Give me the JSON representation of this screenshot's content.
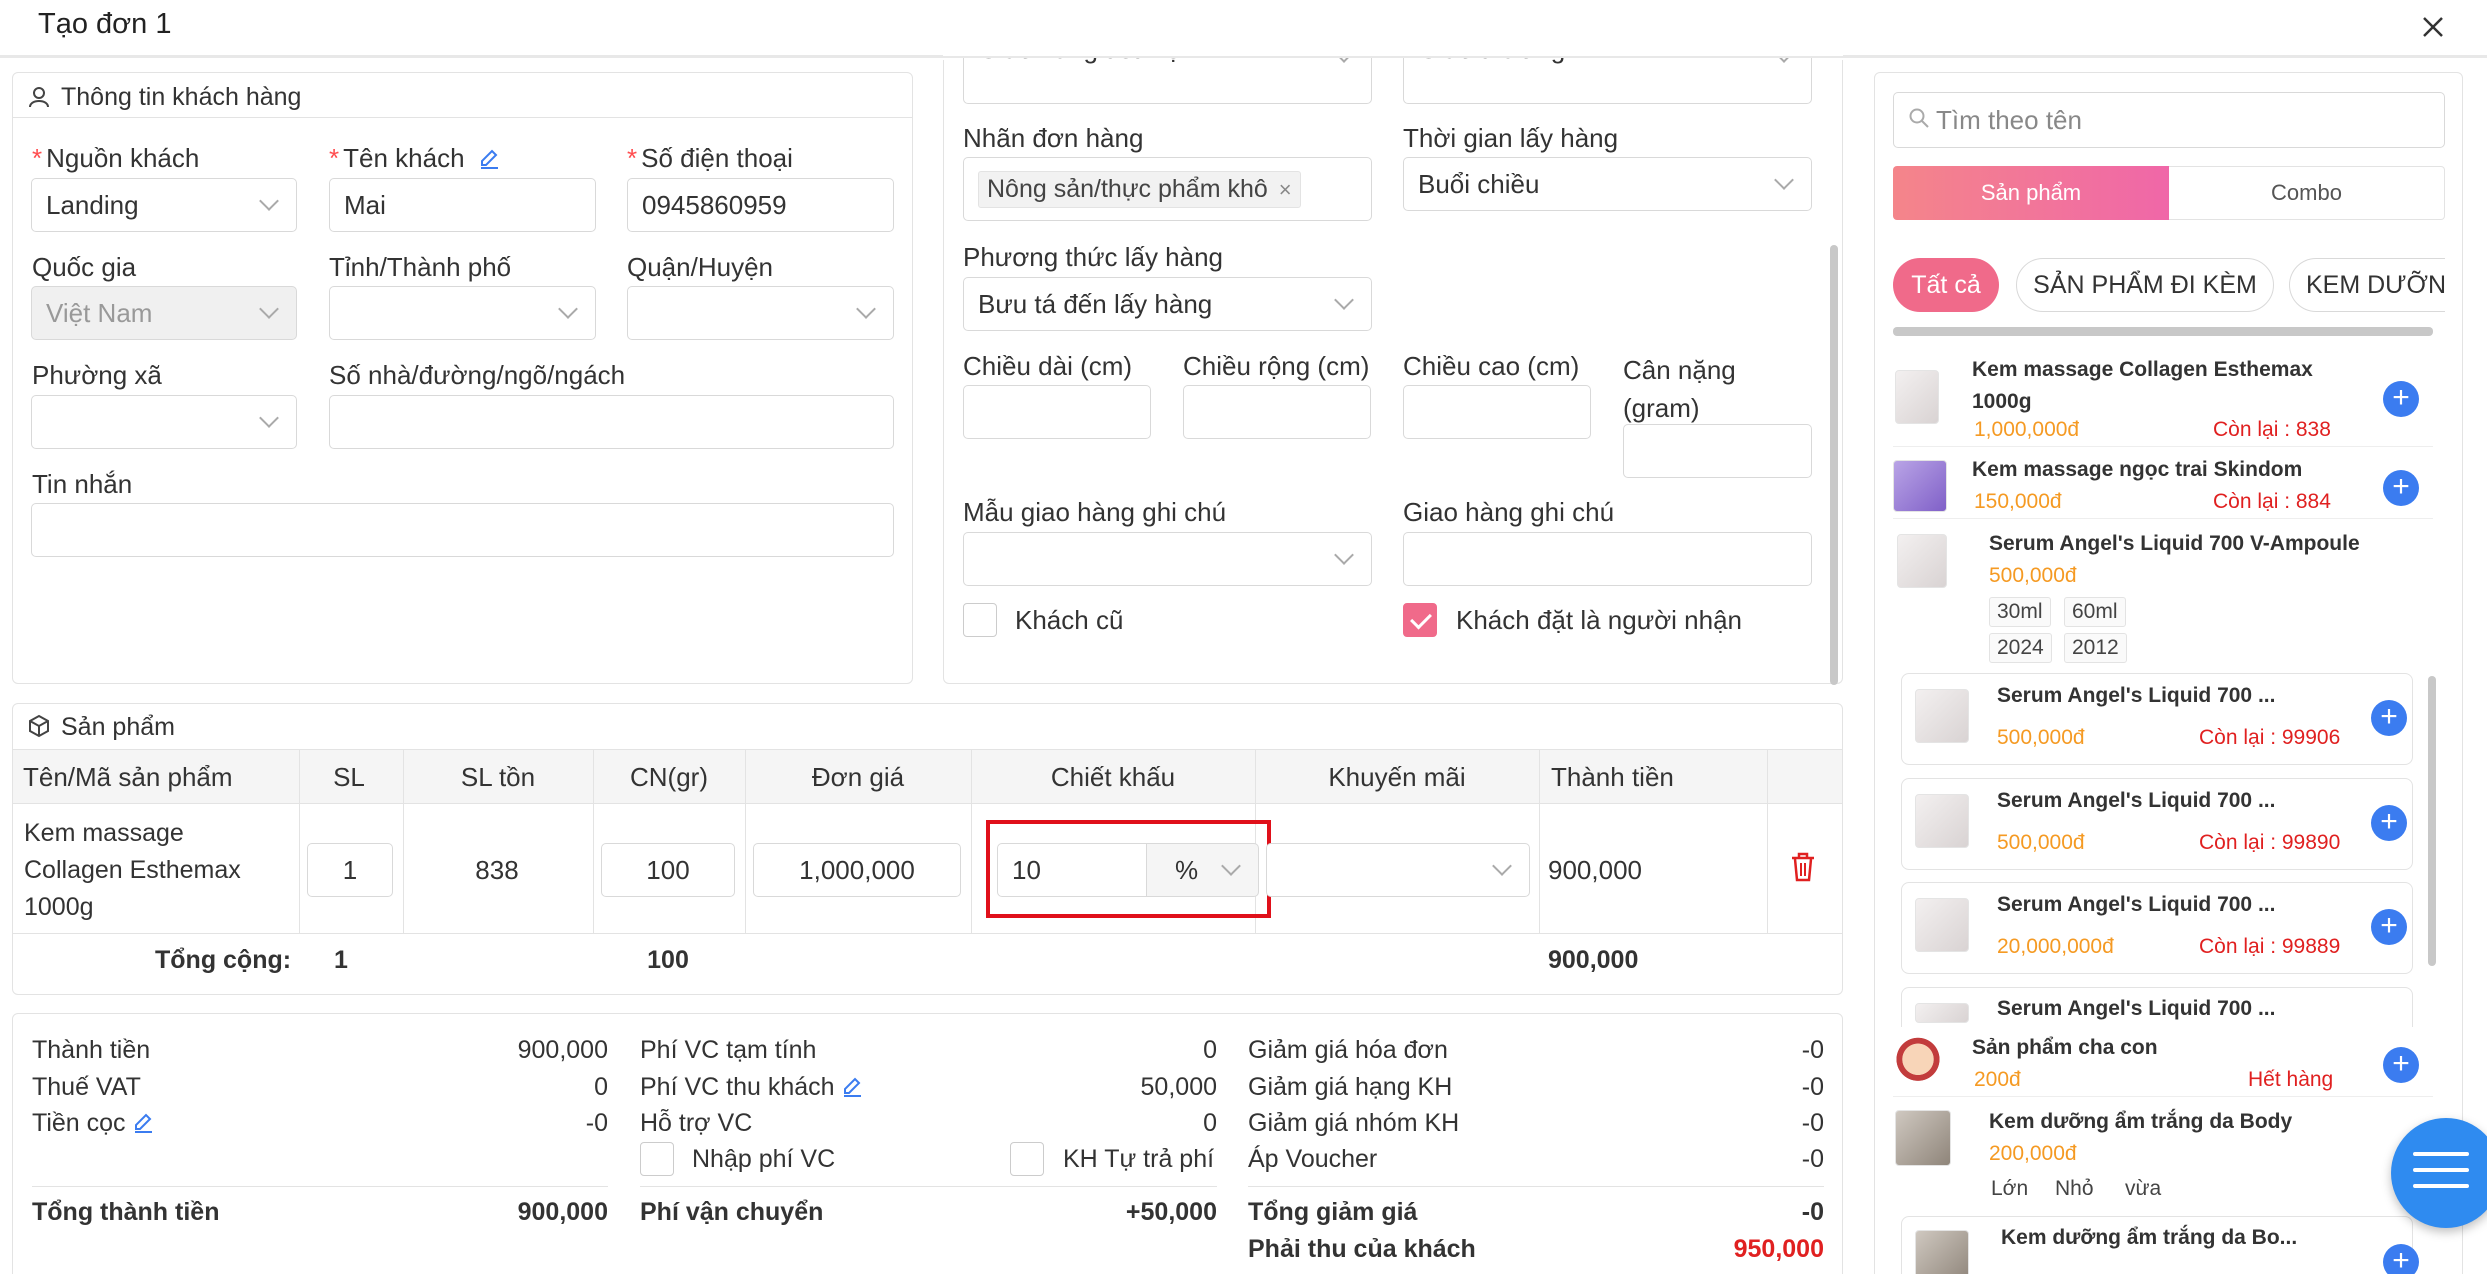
{
  "modal": {
    "title": "Tạo đơn 1"
  },
  "customer": {
    "section_title": "Thông tin khách hàng",
    "source_label": "Nguồn khách",
    "source_value": "Landing",
    "name_label": "Tên khách",
    "name_value": "Mai",
    "phone_label": "Số điện thoại",
    "phone_value": "0945860959",
    "country_label": "Quốc gia",
    "country_value": "Việt Nam",
    "province_label": "Tỉnh/Thành phố",
    "district_label": "Quận/Huyện",
    "ward_label": "Phường xã",
    "address_label": "Số nhà/đường/ngõ/ngách",
    "message_label": "Tin nhắn"
  },
  "shipping": {
    "carrier_value": "Giao hàng tiết kiệm",
    "service_value": "Giao thường",
    "order_tag_label": "Nhãn đơn hàng",
    "order_tag_value": "Nông sản/thực phẩm khô",
    "pickup_time_label": "Thời gian lấy hàng",
    "pickup_time_value": "Buổi chiều",
    "pickup_method_label": "Phương thức lấy hàng",
    "pickup_method_value": "Bưu tá đến lấy hàng",
    "length_label": "Chiều dài (cm)",
    "width_label": "Chiều rộng (cm)",
    "height_label": "Chiều cao (cm)",
    "weight_label_1": "Cân nặng",
    "weight_label_2": "(gram)",
    "note_template_label": "Mẫu giao hàng ghi chú",
    "note_label": "Giao hàng ghi chú",
    "old_customer_label": "Khách cũ",
    "buyer_is_receiver_label": "Khách đặt là người nhận",
    "buyer_is_receiver_checked": true
  },
  "products": {
    "section_title": "Sản phẩm",
    "headers": {
      "name": "Tên/Mã sản phẩm",
      "qty": "SL",
      "stock": "SL tồn",
      "weight": "CN(gr)",
      "price": "Đơn giá",
      "discount": "Chiết khấu",
      "promo": "Khuyến mãi",
      "total": "Thành tiền"
    },
    "row": {
      "name_1": "Kem massage",
      "name_2": "Collagen Esthemax",
      "name_3": "1000g",
      "qty": "1",
      "stock": "838",
      "weight": "100",
      "price": "1,000,000",
      "discount": "10",
      "discount_unit": "%",
      "total": "900,000"
    },
    "footer": {
      "label": "Tổng cộng:",
      "qty": "1",
      "weight": "100",
      "total": "900,000"
    }
  },
  "summary": {
    "col1": {
      "subtotal_label": "Thành tiền",
      "subtotal_value": "900,000",
      "vat_label": "Thuế VAT",
      "vat_value": "0",
      "deposit_label": "Tiền cọc",
      "deposit_value": "-0",
      "grand_label": "Tổng thành tiền",
      "grand_value": "900,000"
    },
    "col2": {
      "est_fee_label": "Phí VC tạm tính",
      "est_fee_value": "0",
      "charged_fee_label": "Phí VC thu khách",
      "charged_fee_value": "50,000",
      "support_label": "Hỗ trợ VC",
      "support_value": "0",
      "enter_fee_label": "Nhập phí VC",
      "self_pay_label": "KH Tự trả phí",
      "ship_label": "Phí vận chuyển",
      "ship_value": "+50,000"
    },
    "col3": {
      "invoice_disc_label": "Giảm giá hóa đơn",
      "invoice_disc_value": "-0",
      "rank_disc_label": "Giảm giá hạng KH",
      "rank_disc_value": "-0",
      "group_disc_label": "Giảm giá nhóm KH",
      "group_disc_value": "-0",
      "voucher_label": "Áp Voucher",
      "voucher_value": "-0",
      "total_disc_label": "Tổng giảm giá",
      "total_disc_value": "-0",
      "collect_label": "Phải thu của khách",
      "collect_value": "950,000"
    }
  },
  "catalog": {
    "search_placeholder": "Tìm theo tên",
    "tab_products": "Sản phẩm",
    "tab_combo": "Combo",
    "filters": [
      "Tất cả",
      "SẢN PHẨM ĐI KÈM",
      "KEM DƯỠN"
    ],
    "items": [
      {
        "name_1": "Kem massage Collagen Esthemax",
        "name_2": "1000g",
        "price": "1,000,000đ",
        "stock": "Còn lại : 838"
      },
      {
        "name": "Kem massage ngọc trai Skindom",
        "price": "150,000đ",
        "stock": "Còn lại : 884"
      },
      {
        "name": "Serum Angel's Liquid 700 V-Ampoule",
        "price": "500,000đ",
        "chips": [
          "30ml",
          "60ml",
          "2024",
          "2012"
        ]
      },
      {
        "name": "Serum Angel's Liquid 700 ...",
        "price": "500,000đ",
        "stock": "Còn lại : 99906"
      },
      {
        "name": "Serum Angel's Liquid 700 ...",
        "price": "500,000đ",
        "stock": "Còn lại : 99890"
      },
      {
        "name": "Serum Angel's Liquid 700 ...",
        "price": "20,000,000đ",
        "stock": "Còn lại : 99889"
      },
      {
        "name": "Serum Angel's Liquid 700 ..."
      },
      {
        "name": "Sản phẩm cha con",
        "price": "200đ",
        "stock": "Hết hàng"
      },
      {
        "name": "Kem dưỡng ẩm trắng da Body",
        "price": "200,000đ",
        "chips": [
          "Lớn",
          "Nhỏ",
          "vừa"
        ]
      },
      {
        "name": "Kem dưỡng ẩm trắng da Bo..."
      }
    ]
  },
  "colors": {
    "accent": "#f06a8a",
    "link": "#3b7cf0",
    "price": "#f59a23",
    "danger": "#e02020",
    "highlight": "#e0101a"
  }
}
